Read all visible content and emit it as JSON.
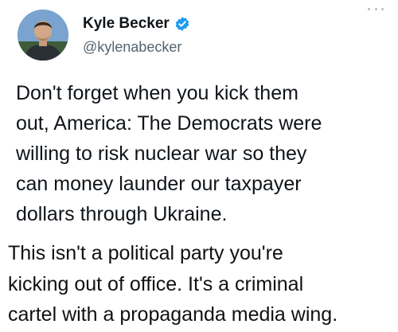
{
  "author": {
    "display_name": "Kyle Becker",
    "handle": "@kylenabecker",
    "verified": true
  },
  "tweet": {
    "text": "Don't forget when you kick them\nout, America: The Democrats were\nwilling to risk nuclear war so they\ncan money launder our taxpayer\ndollars through Ukraine."
  },
  "caption": {
    "text": "This isn't a political party you're\nkicking out of office. It's a criminal\ncartel with a propaganda media wing."
  },
  "icons": {
    "verified": "verified-badge-icon",
    "more": "more-options-icon"
  },
  "colors": {
    "verified_blue": "#1d9bf0",
    "handle_gray": "#536471",
    "text": "#0f1419"
  }
}
